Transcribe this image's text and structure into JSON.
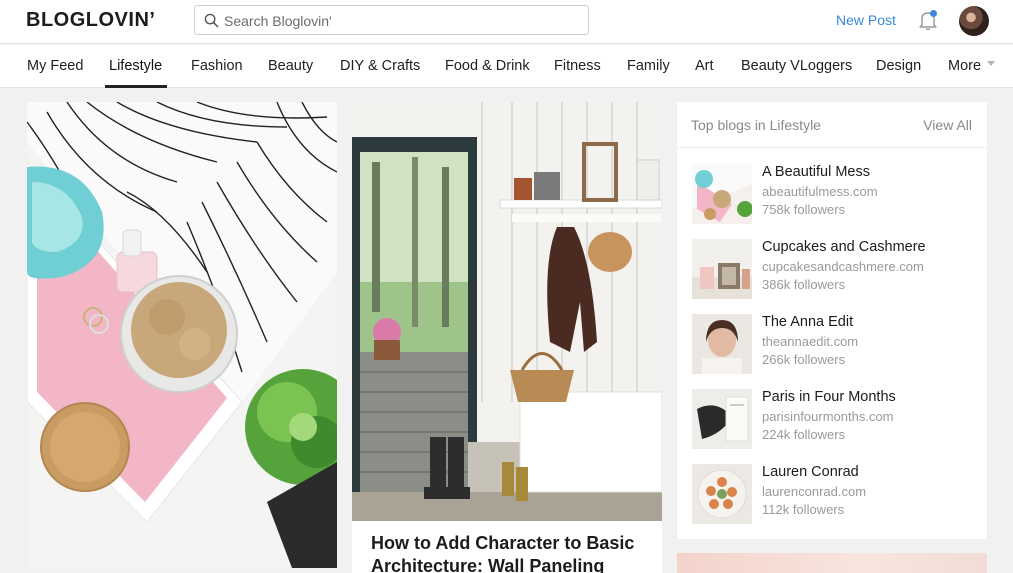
{
  "header": {
    "logo": "BLOGLOVIN’",
    "search_placeholder": "Search Bloglovin'",
    "new_post_label": "New Post"
  },
  "nav": {
    "items": [
      {
        "label": "My Feed"
      },
      {
        "label": "Lifestyle",
        "active": true
      },
      {
        "label": "Fashion"
      },
      {
        "label": "Beauty"
      },
      {
        "label": "DIY & Crafts"
      },
      {
        "label": "Food & Drink"
      },
      {
        "label": "Fitness"
      },
      {
        "label": "Family"
      },
      {
        "label": "Art"
      },
      {
        "label": "Beauty VLoggers"
      },
      {
        "label": "Design"
      },
      {
        "label": "More"
      }
    ]
  },
  "feed": {
    "cards": [
      {
        "image": "pink-tray-flatlay-image"
      },
      {
        "image": "entryway-wall-paneling-image",
        "title": "How to Add Character to Basic Architecture: Wall Paneling"
      }
    ]
  },
  "sidebar": {
    "title": "Top blogs in Lifestyle",
    "view_all": "View All",
    "blogs": [
      {
        "name": "A Beautiful Mess",
        "url": "abeautifulmess.com",
        "followers": "758k followers"
      },
      {
        "name": "Cupcakes and Cashmere",
        "url": "cupcakesandcashmere.com",
        "followers": "386k followers"
      },
      {
        "name": "The Anna Edit",
        "url": "theannaedit.com",
        "followers": "266k followers"
      },
      {
        "name": "Paris in Four Months",
        "url": "parisinfourmonths.com",
        "followers": "224k followers"
      },
      {
        "name": "Lauren Conrad",
        "url": "laurenconrad.com",
        "followers": "112k followers"
      }
    ]
  },
  "colors": {
    "accent": "#3a8ad6",
    "background": "#f1f1f1"
  }
}
